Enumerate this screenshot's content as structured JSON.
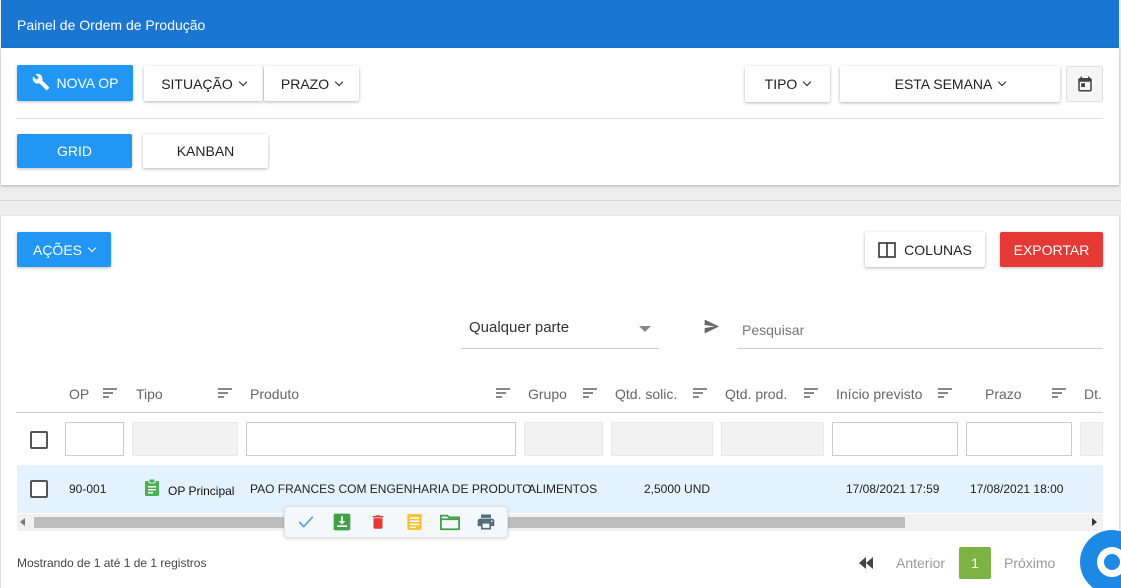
{
  "header": {
    "title": "Painel de Ordem de Produção"
  },
  "toolbar": {
    "nova_op": "NOVA OP",
    "situacao": "SITUAÇÃO",
    "prazo": "PRAZO",
    "tipo": "TIPO",
    "periodo": "ESTA SEMANA"
  },
  "view": {
    "grid": "GRID",
    "kanban": "KANBAN"
  },
  "actions": {
    "acoes": "AÇÕES",
    "colunas": "COLUNAS",
    "exportar": "EXPORTAR"
  },
  "search": {
    "scope": "Qualquer parte",
    "placeholder": "Pesquisar"
  },
  "table": {
    "columns": [
      "OP",
      "Tipo",
      "Produto",
      "Grupo",
      "Qtd. solic.",
      "Qtd. prod.",
      "Início previsto",
      "Prazo",
      "Dt."
    ],
    "rows": [
      {
        "op": "90-001",
        "tipo": "OP Principal",
        "produto": "PAO FRANCES COM ENGENHARIA DE PRODUTO",
        "grupo": "ALIMENTOS",
        "qtd_solic": "2,5000 UND",
        "qtd_prod": "",
        "inicio": "17/08/2021 17:59",
        "prazo": "17/08/2021 18:00"
      }
    ]
  },
  "row_actions": [
    "check-icon",
    "download-box-icon",
    "delete-icon",
    "notes-icon",
    "folder-icon",
    "print-icon"
  ],
  "footer": {
    "info": "Mostrando de 1 até 1 de 1 registros",
    "anterior": "Anterior",
    "page": "1",
    "proximo": "Próximo"
  },
  "colors": {
    "primary": "#1976d2",
    "button_blue": "#2196f3",
    "danger": "#e53935",
    "selected_row": "#e3f2fd",
    "green": "#4caf50"
  }
}
